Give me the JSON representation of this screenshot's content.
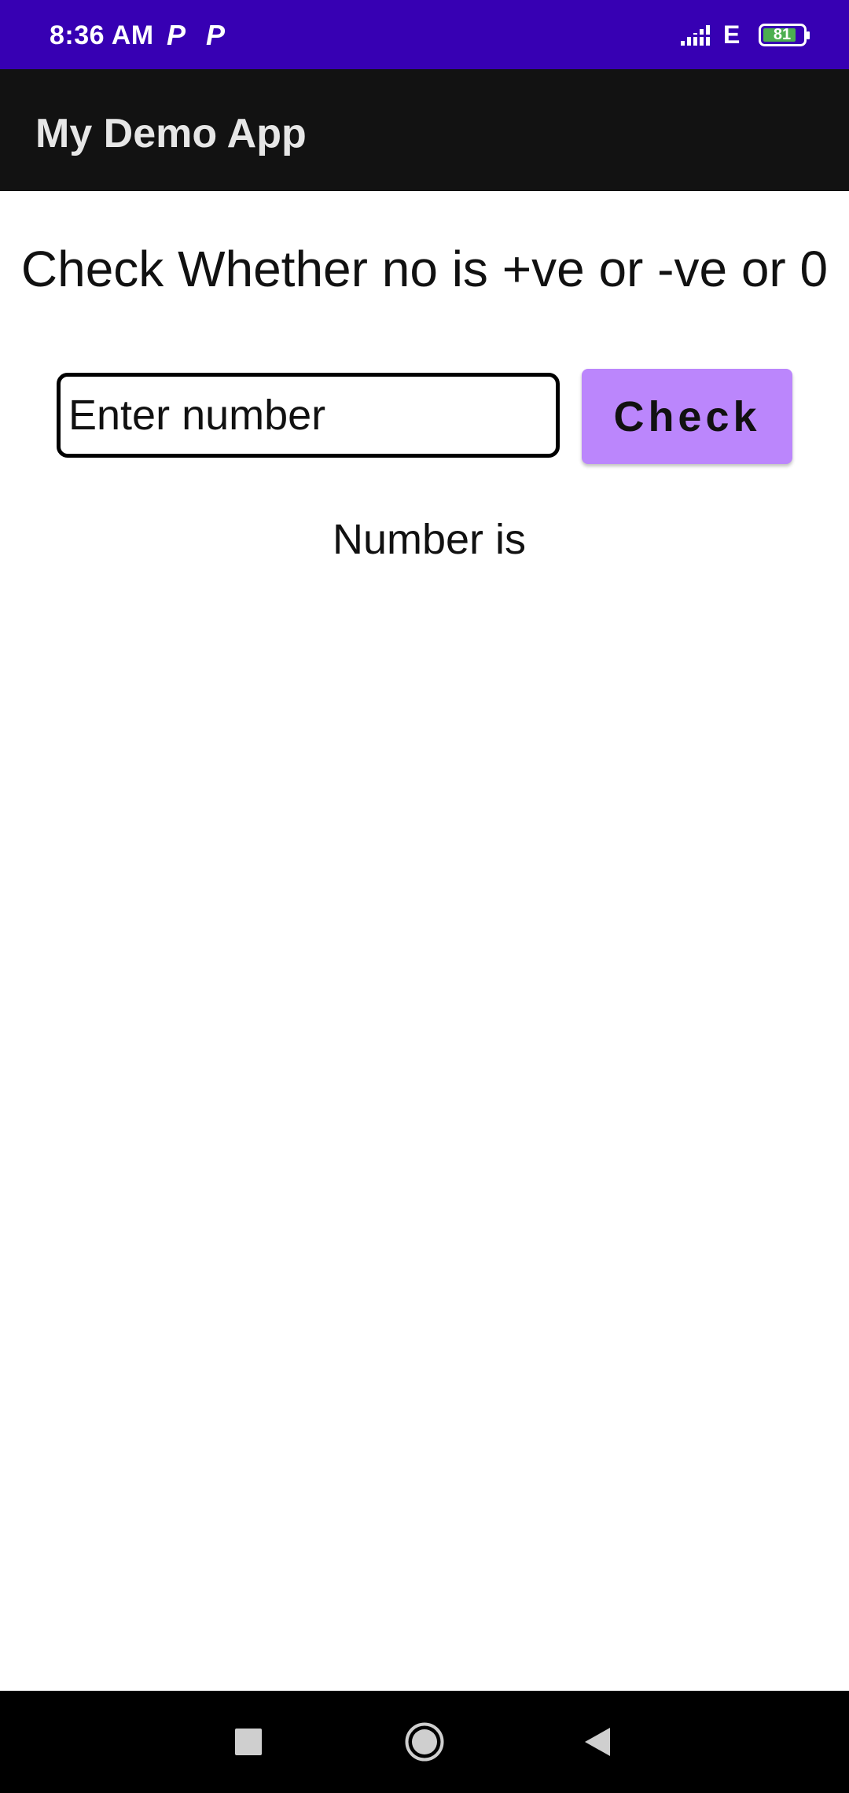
{
  "status_bar": {
    "time": "8:36 AM",
    "notification_icons": [
      "P",
      "P"
    ],
    "network_type": "E",
    "battery_level": "81",
    "background_color": "#3700b3"
  },
  "app_bar": {
    "title": "My Demo App",
    "background_color": "#121212"
  },
  "main": {
    "heading": "Check Whether no is +ve or -ve or 0",
    "number_input": {
      "value": "",
      "placeholder": "Enter number"
    },
    "check_button_label": "Check",
    "check_button_color": "#bb86fc",
    "result_text": "Number is"
  },
  "nav_bar": {
    "buttons": [
      "recent-apps-icon",
      "home-icon",
      "back-icon"
    ]
  }
}
